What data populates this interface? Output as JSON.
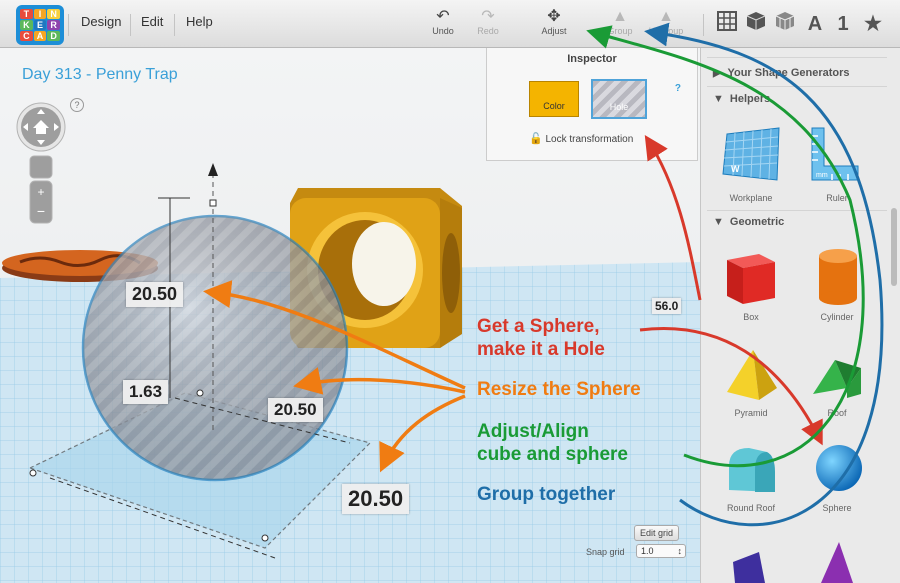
{
  "logo": {
    "letters": [
      "T",
      "I",
      "N",
      "K",
      "E",
      "R",
      "C",
      "A",
      "D"
    ],
    "colors": [
      "#e84b3c",
      "#f5a623",
      "#f8d03e",
      "#5cb85c",
      "#1f78c1",
      "#8e44ad",
      "#e84b3c",
      "#f5a623",
      "#5cb85c"
    ]
  },
  "menu": {
    "design": "Design",
    "edit": "Edit",
    "help": "Help"
  },
  "toolbar": {
    "undo": "Undo",
    "redo": "Redo",
    "adjust": "Adjust",
    "group": "Group",
    "ungroup": "Ungroup"
  },
  "right_tools": {
    "letter": "A",
    "number": "1"
  },
  "design_title": "Day 313 - Penny Trap",
  "help_mark": "?",
  "inspector": {
    "title": "Inspector",
    "color_label": "Color",
    "hole_label": "Hole",
    "help": "?",
    "lock_label": "Lock transformation",
    "color_hex": "#f4b400"
  },
  "sidebar": {
    "your_generators": "Your Shape Generators",
    "helpers": "Helpers",
    "helper_items": [
      "Workplane",
      "Ruler"
    ],
    "geometric": "Geometric",
    "geometric_items": [
      "Box",
      "Cylinder",
      "Pyramid",
      "Roof",
      "Round Roof",
      "Sphere"
    ]
  },
  "dimensions": {
    "height": "20.50",
    "elevation": "1.63",
    "depth": "20.50",
    "width": "20.50",
    "edge": "56.0"
  },
  "annotations": {
    "get_sphere": "Get a Sphere,\nmake it a Hole",
    "resize": "Resize the Sphere",
    "adjust": "Adjust/Align\ncube and sphere",
    "group": "Group together"
  },
  "annotation_colors": {
    "red": "#d8392b",
    "orange": "#f07c12",
    "green": "#1a9b36",
    "blue": "#1f6ea8"
  },
  "bottom": {
    "edit_grid": "Edit grid",
    "snap_label": "Snap grid",
    "snap_value": "1.0"
  }
}
